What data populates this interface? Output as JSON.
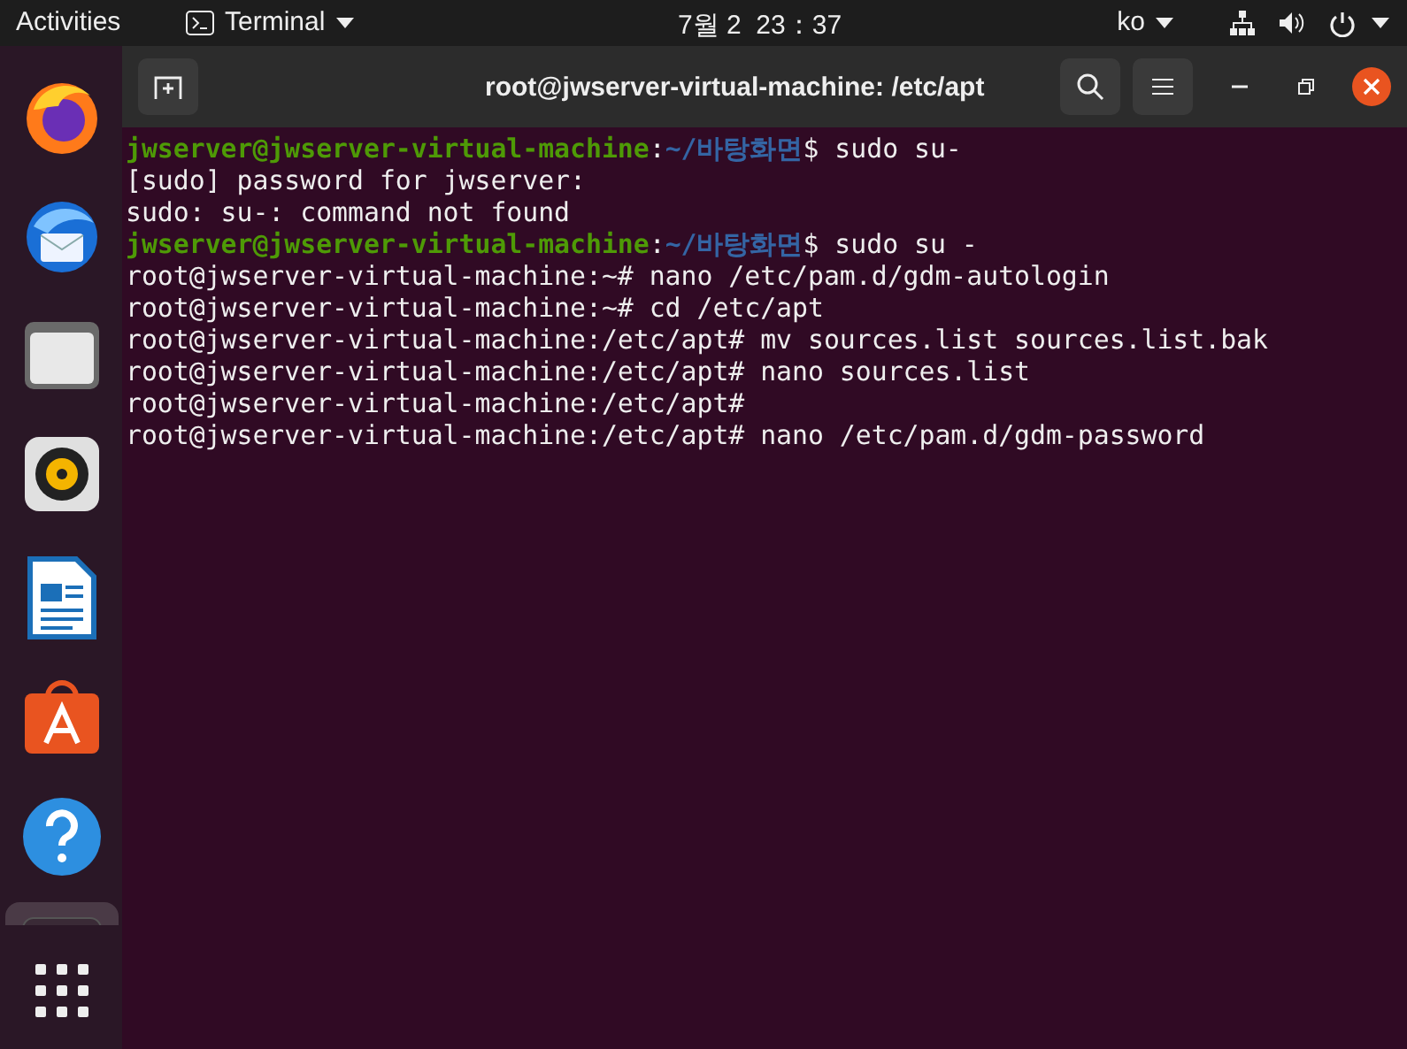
{
  "top_bar": {
    "activities": "Activities",
    "app_menu": "Terminal",
    "clock": "7월 2  23：37",
    "input_method": "ko"
  },
  "dock": {
    "items": [
      {
        "kind": "firefox",
        "selected": false
      },
      {
        "kind": "thunderbird",
        "selected": false
      },
      {
        "kind": "files",
        "selected": false
      },
      {
        "kind": "rhythmbox",
        "selected": false
      },
      {
        "kind": "writer",
        "selected": false
      },
      {
        "kind": "software",
        "selected": false
      },
      {
        "kind": "help",
        "selected": false
      },
      {
        "kind": "terminal",
        "selected": true
      }
    ]
  },
  "window": {
    "title": "root@jwserver-virtual-machine: /etc/apt"
  },
  "terminal": {
    "lines": [
      [
        {
          "kind": "user",
          "text": "jwserver@jwserver-virtual-machine"
        },
        {
          "kind": "text",
          "text": ":"
        },
        {
          "kind": "path",
          "text": "~/바탕화면"
        },
        {
          "kind": "text",
          "text": "$ sudo su-"
        }
      ],
      [
        {
          "kind": "text",
          "text": "[sudo] password for jwserver:"
        }
      ],
      [
        {
          "kind": "text",
          "text": "sudo: su-: command not found"
        }
      ],
      [
        {
          "kind": "user",
          "text": "jwserver@jwserver-virtual-machine"
        },
        {
          "kind": "text",
          "text": ":"
        },
        {
          "kind": "path",
          "text": "~/바탕화면"
        },
        {
          "kind": "text",
          "text": "$ sudo su -"
        }
      ],
      [
        {
          "kind": "text",
          "text": "root@jwserver-virtual-machine:~# nano /etc/pam.d/gdm-autologin"
        }
      ],
      [
        {
          "kind": "text",
          "text": "root@jwserver-virtual-machine:~# cd /etc/apt"
        }
      ],
      [
        {
          "kind": "text",
          "text": "root@jwserver-virtual-machine:/etc/apt# mv sources.list sources.list.bak"
        }
      ],
      [
        {
          "kind": "text",
          "text": "root@jwserver-virtual-machine:/etc/apt# nano sources.list"
        }
      ],
      [
        {
          "kind": "text",
          "text": "root@jwserver-virtual-machine:/etc/apt#"
        }
      ],
      [
        {
          "kind": "text",
          "text": "root@jwserver-virtual-machine:/etc/apt# nano /etc/pam.d/gdm-password"
        }
      ]
    ]
  }
}
